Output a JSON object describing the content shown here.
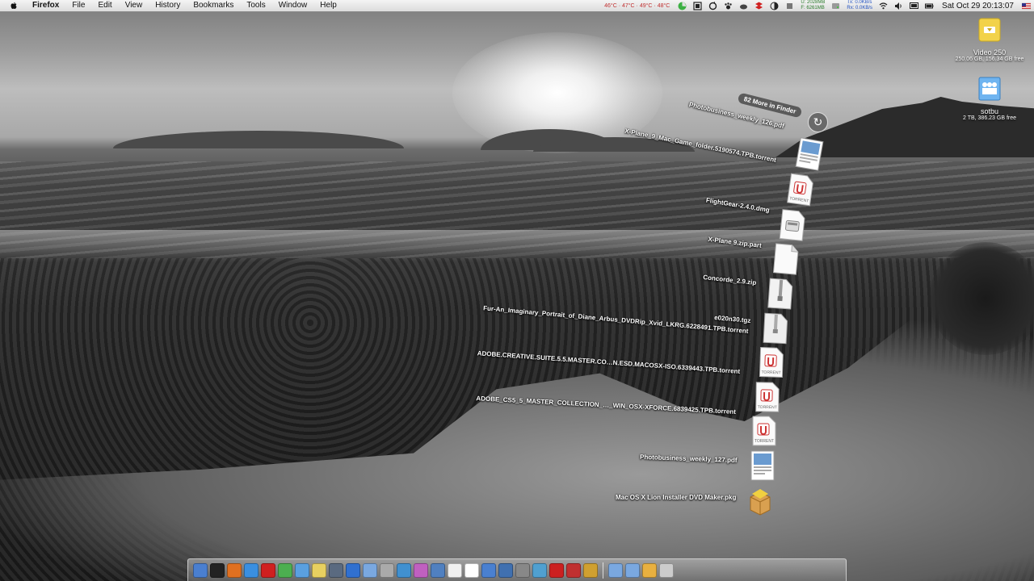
{
  "menubar": {
    "app_name": "Firefox",
    "menus": [
      "File",
      "Edit",
      "View",
      "History",
      "Bookmarks",
      "Tools",
      "Window",
      "Help"
    ],
    "temps": "46°C · 47°C · 49°C · 48°C",
    "memory_used": "U: 2028MB",
    "memory_free": "F: 6261MB",
    "net_tx": "Tx: 0.0KB/s",
    "net_rx": "Rx: 0.0KB/s",
    "clock": "Sat Oct 29  20:13:07"
  },
  "desktop": {
    "drives": [
      {
        "label": "Video 250",
        "info": "250.06 GB, 156.34 GB free",
        "icon": "external-drive-icon"
      },
      {
        "label": "sotbu",
        "info": "2 TB, 386.23 GB free",
        "icon": "network-drive-icon"
      }
    ]
  },
  "stack": {
    "more_label": "82 More in Finder",
    "items": [
      {
        "label": "Photobusiness_weekly_126.pdf",
        "icon": "pdf-thumbnail-icon"
      },
      {
        "label": "X-Plane_9_Mac_Game_folder.5190574.TPB.torrent",
        "icon": "torrent-file-icon"
      },
      {
        "label": "FlightGear-2.4.0.dmg",
        "icon": "disk-image-icon"
      },
      {
        "label": "X-Plane 9.zip.part",
        "icon": "document-icon"
      },
      {
        "label": "Concorde_2.9.zip",
        "icon": "zip-file-icon"
      },
      {
        "label": "e020n30.tgz",
        "icon": "tgz-file-icon"
      },
      {
        "label": "Fur-An_Imaginary_Portrait_of_Diane_Arbus_DVDRip_Xvid_LKRG.6228491.TPB.torrent",
        "icon": "torrent-file-icon"
      },
      {
        "label": "ADOBE.CREATIVE.SUITE.5.5.MASTER.CO…N.ESD.MACOSX-ISO.6339443.TPB.torrent",
        "icon": "torrent-file-icon"
      },
      {
        "label": "ADOBE_CS5_5_MASTER_COLLECTION_…_WIN_OSX-XFORCE.6839425.TPB.torrent",
        "icon": "torrent-file-icon"
      },
      {
        "label": "Photobusiness_weekly_127.pdf",
        "icon": "pdf-thumbnail-icon"
      },
      {
        "label": "Mac OS X Lion Installer DVD Maker.pkg",
        "icon": "package-icon"
      }
    ],
    "torrent_badge": "TORRENT"
  },
  "dock": {
    "apps": [
      {
        "name": "finder-icon",
        "color": "#4a7fd0"
      },
      {
        "name": "terminal-icon",
        "color": "#222222"
      },
      {
        "name": "firefox-icon",
        "color": "#e07020"
      },
      {
        "name": "safari-icon",
        "color": "#3a8fe0"
      },
      {
        "name": "opera-icon",
        "color": "#d02020"
      },
      {
        "name": "chrome-icon",
        "color": "#4caf50"
      },
      {
        "name": "browser-icon",
        "color": "#5aa0e0"
      },
      {
        "name": "notes-icon",
        "color": "#e8d060"
      },
      {
        "name": "lightroom-icon",
        "color": "#5a6a80"
      },
      {
        "name": "app-store-icon",
        "color": "#3070d0"
      },
      {
        "name": "folder-icon",
        "color": "#7aa8e0"
      },
      {
        "name": "photo-icon",
        "color": "#aaaaaa"
      },
      {
        "name": "itunes-icon",
        "color": "#4090d0"
      },
      {
        "name": "music-icon",
        "color": "#c060c0"
      },
      {
        "name": "globe-icon",
        "color": "#5080c0"
      },
      {
        "name": "textedit-icon",
        "color": "#f0f0f0"
      },
      {
        "name": "calendar-icon",
        "color": "#ffffff"
      },
      {
        "name": "mail-icon",
        "color": "#4a80d0"
      },
      {
        "name": "xcode-icon",
        "color": "#4070b0"
      },
      {
        "name": "preferences-icon",
        "color": "#888888"
      },
      {
        "name": "network-icon",
        "color": "#50a0d0"
      },
      {
        "name": "acrobat-icon",
        "color": "#cc2020"
      },
      {
        "name": "filezilla-icon",
        "color": "#c03030"
      },
      {
        "name": "utility-icon",
        "color": "#d0a030"
      },
      {
        "name": "applications-folder-icon",
        "color": "#7aa8e0"
      },
      {
        "name": "documents-folder-icon",
        "color": "#7aa8e0"
      },
      {
        "name": "downloads-stack-icon",
        "color": "#e8b040"
      },
      {
        "name": "trash-icon",
        "color": "#cccccc"
      }
    ]
  }
}
